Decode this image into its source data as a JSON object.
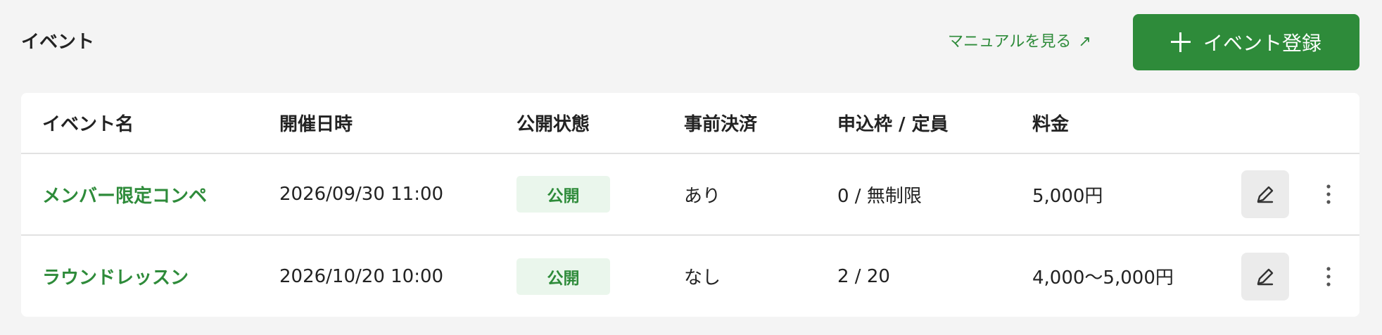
{
  "header": {
    "title": "イベント",
    "manual_link": "マニュアルを見る",
    "manual_link_icon": "external-link-arrow",
    "add_button_label": "イベント登録"
  },
  "table": {
    "columns": [
      "イベント名",
      "開催日時",
      "公開状態",
      "事前決済",
      "申込枠 / 定員",
      "料金"
    ],
    "rows": [
      {
        "name": "メンバー限定コンペ",
        "datetime": "2026/09/30 11:00",
        "status": "公開",
        "prepayment": "あり",
        "capacity": "0 / 無制限",
        "price": "5,000円"
      },
      {
        "name": "ラウンドレッスン",
        "datetime": "2026/10/20 10:00",
        "status": "公開",
        "prepayment": "なし",
        "capacity": "2 / 20",
        "price": "4,000〜5,000円"
      }
    ]
  },
  "colors": {
    "accent": "#2e8b3a",
    "badge_bg": "#eaf6ec",
    "page_bg": "#f4f4f4"
  }
}
